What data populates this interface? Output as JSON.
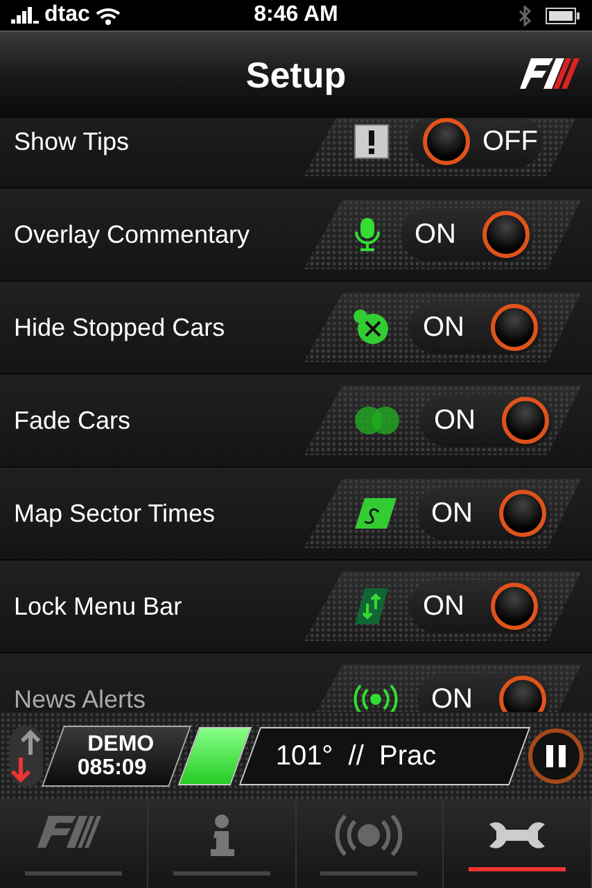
{
  "status_bar": {
    "carrier": "dtac",
    "time": "8:46 AM"
  },
  "nav_bar": {
    "title": "Setup"
  },
  "settings": [
    {
      "label": "Show Tips",
      "state_text": "OFF",
      "on": false
    },
    {
      "label": "Overlay Commentary",
      "state_text": "ON",
      "on": true
    },
    {
      "label": "Hide Stopped Cars",
      "state_text": "ON",
      "on": true
    },
    {
      "label": "Fade Cars",
      "state_text": "ON",
      "on": true
    },
    {
      "label": "Map Sector Times",
      "state_text": "ON",
      "on": true
    },
    {
      "label": "Lock Menu Bar",
      "state_text": "ON",
      "on": true
    },
    {
      "label": "News Alerts",
      "state_text": "ON",
      "on": true
    }
  ],
  "session_bar": {
    "mode": "DEMO",
    "clock": "085:09",
    "ticker": "101°  //  Prac"
  },
  "tabs": [
    {
      "selected": false
    },
    {
      "selected": false
    },
    {
      "selected": false
    },
    {
      "selected": true
    }
  ]
}
